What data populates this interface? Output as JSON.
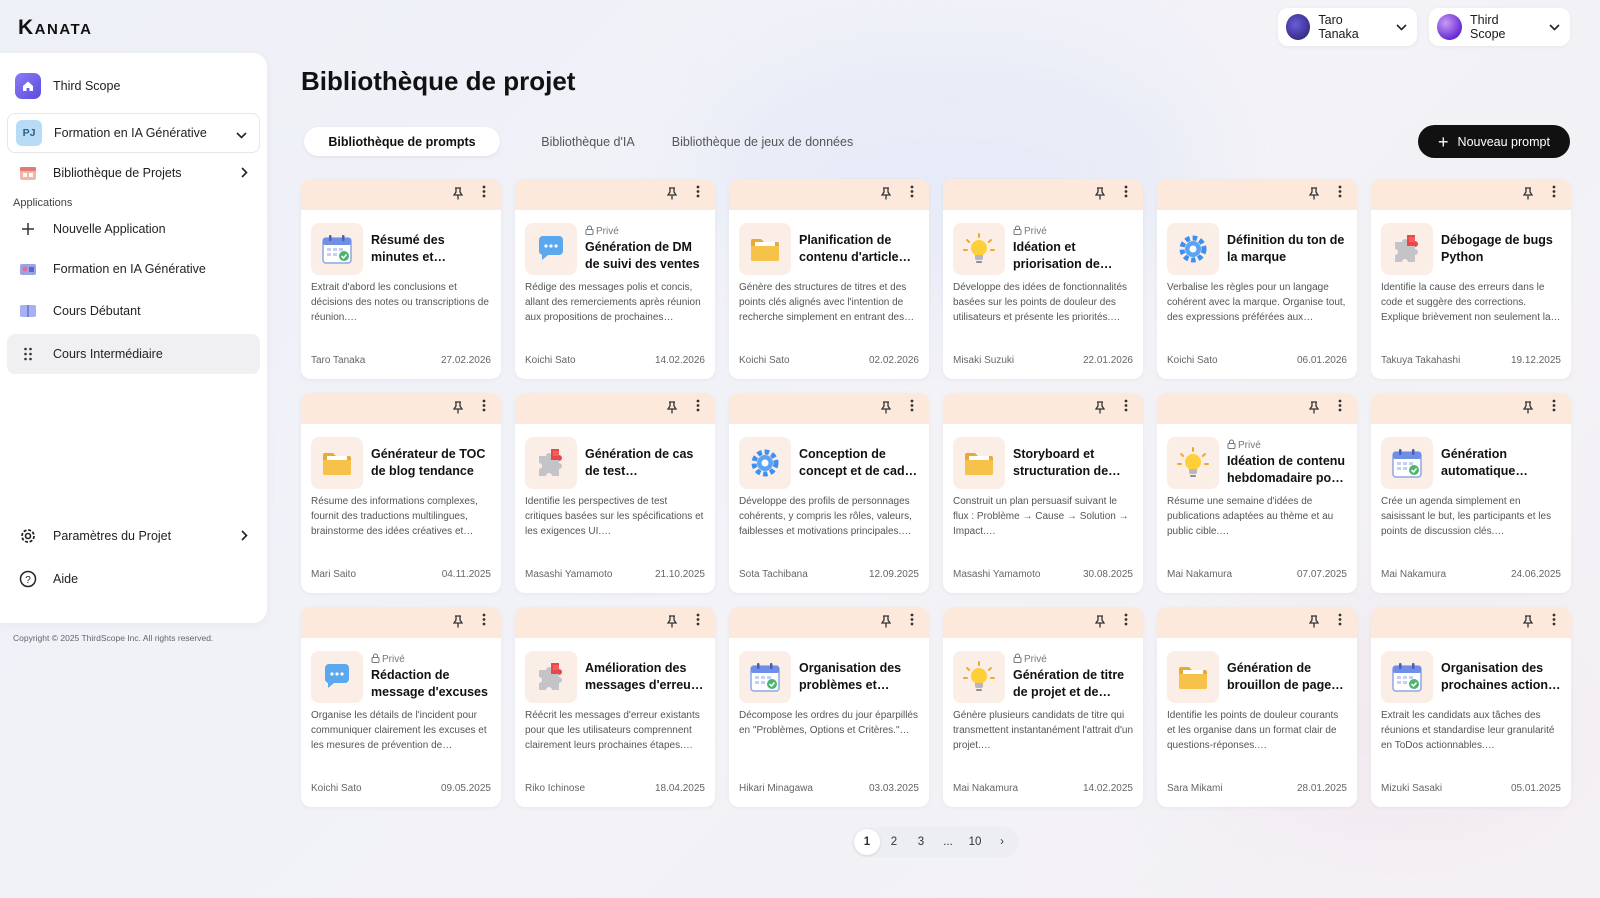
{
  "brand": {
    "logo_text": "Kanata"
  },
  "header": {
    "user": {
      "name": "Taro Tanaka"
    },
    "workspace": {
      "name": "Third Scope"
    }
  },
  "sidebar": {
    "workspace_label": "Third Scope",
    "project_label": "Formation en IA Générative",
    "project_badge": "PJ",
    "library_label": "Bibliothèque de Projets",
    "section_label": "Applications",
    "apps": [
      {
        "label": "Nouvelle Application"
      },
      {
        "label": "Formation en IA Générative"
      },
      {
        "label": "Cours Débutant"
      },
      {
        "label": "Cours Intermédiaire"
      }
    ],
    "settings_label": "Paramètres du Projet",
    "help_label": "Aide",
    "copyright": "Copyright © 2025 ThirdScope Inc. All rights reserved."
  },
  "page": {
    "title": "Bibliothèque de projet"
  },
  "tabs": [
    {
      "label": "Bibliothèque de prompts",
      "active": true
    },
    {
      "label": "Bibliothèque d'IA",
      "active": false
    },
    {
      "label": "Bibliothèque de jeux de données",
      "active": false
    }
  ],
  "new_button_label": "Nouveau prompt",
  "private_label": "Privé",
  "cards": [
    {
      "icon": "calendar",
      "private": false,
      "title": "Résumé des minutes et extraction des actions",
      "desc": "Extrait d'abord les conclusions et décisions des notes ou transcriptions de réunion.…",
      "author": "Taro Tanaka",
      "date": "27.02.2026"
    },
    {
      "icon": "chat",
      "private": true,
      "title": "Génération de DM de suivi des ventes",
      "desc": "Rédige des messages polis et concis, allant des remerciements après réunion aux propositions de prochaines étapes.…",
      "author": "Koichi Sato",
      "date": "14.02.2026"
    },
    {
      "icon": "folder",
      "private": false,
      "title": "Planification de contenu d'article SEO",
      "desc": "Génère des structures de titres et des points clés alignés avec l'intention de recherche simplement en entrant des mots-clés.…",
      "author": "Koichi Sato",
      "date": "02.02.2026"
    },
    {
      "icon": "bulb",
      "private": true,
      "title": "Idéation et priorisation de nouvelles fonctions",
      "desc": "Développe des idées de fonctionnalités basées sur les points de douleur des utilisateurs et présente les priorités.…",
      "author": "Misaki Suzuki",
      "date": "22.01.2026"
    },
    {
      "icon": "gear",
      "private": false,
      "title": "Définition du ton de la marque",
      "desc": "Verbalise les règles pour un langage cohérent avec la marque. Organise tout, des expressions préférées aux expressions à éviter.…",
      "author": "Koichi Sato",
      "date": "06.01.2026"
    },
    {
      "icon": "puzzle",
      "private": false,
      "title": "Débogage de bugs Python",
      "desc": "Identifie la cause des erreurs dans le code et suggère des corrections. Explique brièvement non seulement la solution mais aussi la cause.…",
      "author": "Takuya Takahashi",
      "date": "19.12.2025"
    },
    {
      "icon": "folder",
      "private": false,
      "title": "Générateur de TOC de blog tendance",
      "desc": "Résume des informations complexes, fournit des traductions multilingues, brainstorme des idées créatives et génère du texte.…",
      "author": "Mari Saito",
      "date": "04.11.2025"
    },
    {
      "icon": "puzzle",
      "private": false,
      "title": "Génération de cas de test (Frontend/Backend)",
      "desc": "Identifie les perspectives de test critiques basées sur les spécifications et les exigences UI.…",
      "author": "Masashi Yamamoto",
      "date": "21.10.2025"
    },
    {
      "icon": "gear",
      "private": false,
      "title": "Conception de concept et de cadre persona",
      "desc": "Développe des profils de personnages cohérents, y compris les rôles, valeurs, faiblesses et motivations principales.…",
      "author": "Sota Tachibana",
      "date": "12.09.2025"
    },
    {
      "icon": "folder",
      "private": false,
      "title": "Storyboard et structuration de présentation",
      "desc": "Construit un plan persuasif suivant le flux : Problème → Cause → Solution → Impact.…",
      "author": "Masashi Yamamoto",
      "date": "30.08.2025"
    },
    {
      "icon": "bulb",
      "private": true,
      "title": "Idéation de contenu hebdomadaire pour les réseaux",
      "desc": "Résume une semaine d'idées de publications adaptées au thème et au public cible.…",
      "author": "Mai Nakamura",
      "date": "07.07.2025"
    },
    {
      "icon": "calendar",
      "private": false,
      "title": "Génération automatique d'agenda de réunion",
      "desc": "Crée un agenda simplement en saisissant le but, les participants et les points de discussion clés.…",
      "author": "Mai Nakamura",
      "date": "24.06.2025"
    },
    {
      "icon": "chat",
      "private": true,
      "title": "Rédaction de message d'excuses",
      "desc": "Organise les détails de l'incident pour communiquer clairement les excuses et les mesures de prévention de récurrence.…",
      "author": "Koichi Sato",
      "date": "09.05.2025"
    },
    {
      "icon": "puzzle",
      "private": false,
      "title": "Amélioration des messages d'erreur UI",
      "desc": "Réécrit les messages d'erreur existants pour que les utilisateurs comprennent clairement leurs prochaines étapes.…",
      "author": "Riko Ichinose",
      "date": "18.04.2025"
    },
    {
      "icon": "calendar",
      "private": false,
      "title": "Organisation des problèmes et soutien à la décision",
      "desc": "Décompose les ordres du jour éparpillés en \"Problèmes, Options et Critères.\"…",
      "author": "Hikari Minagawa",
      "date": "03.03.2025"
    },
    {
      "icon": "bulb",
      "private": true,
      "title": "Génération de titre de projet et de slogan",
      "desc": "Génère plusieurs candidats de titre qui transmettent instantanément l'attrait d'un projet.…",
      "author": "Mai Nakamura",
      "date": "14.02.2025"
    },
    {
      "icon": "folder",
      "private": false,
      "title": "Génération de brouillon de page FAQ",
      "desc": "Identifie les points de douleur courants et les organise dans un format clair de questions-réponses.…",
      "author": "Sara Mikami",
      "date": "28.01.2025"
    },
    {
      "icon": "calendar",
      "private": false,
      "title": "Organisation des prochaines actions de réunion",
      "desc": "Extrait les candidats aux tâches des réunions et standardise leur granularité en ToDos actionnables.…",
      "author": "Mizuki Sasaki",
      "date": "05.01.2025"
    }
  ],
  "pagination": {
    "pages": [
      "1",
      "2",
      "3",
      "...",
      "10"
    ],
    "current": "1",
    "next": "›"
  }
}
